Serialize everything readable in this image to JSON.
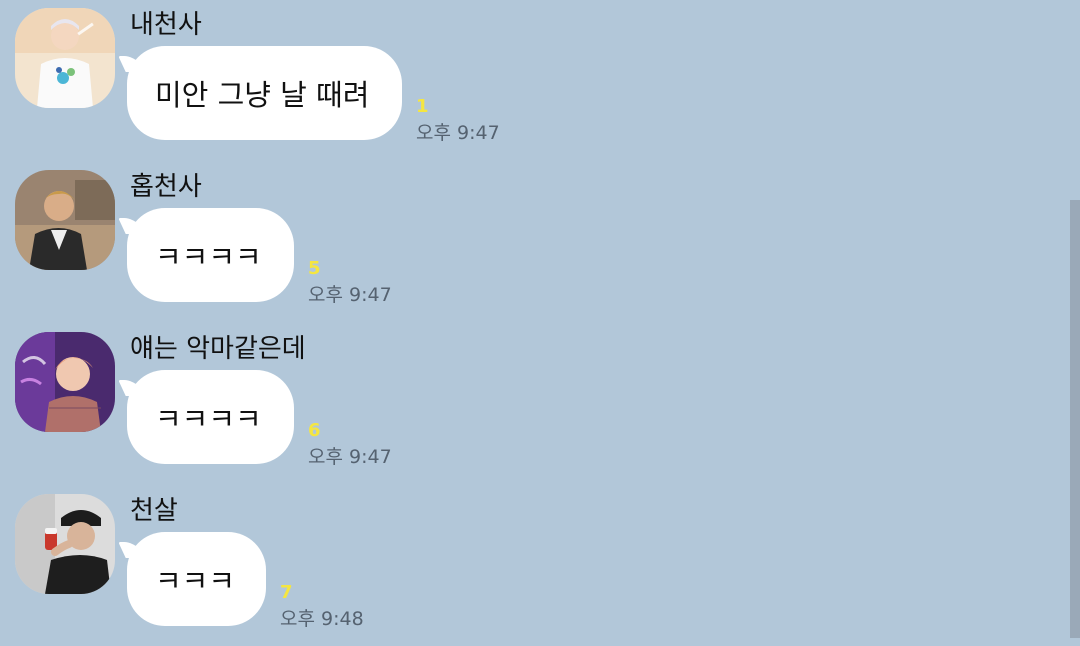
{
  "messages": [
    {
      "sender": "내천사",
      "text": "미안 그냥 날 때려",
      "unread": "1",
      "time": "오후 9:47",
      "avatar": "avatar-white-shirt"
    },
    {
      "sender": "홉천사",
      "text": "ㅋㅋㅋㅋ",
      "unread": "5",
      "time": "오후 9:47",
      "avatar": "avatar-outdoor"
    },
    {
      "sender": "얘는 악마같은데",
      "text": "ㅋㅋㅋㅋ",
      "unread": "6",
      "time": "오후 9:47",
      "avatar": "avatar-neon-purple"
    },
    {
      "sender": "천살",
      "text": "ㅋㅋㅋ",
      "unread": "7",
      "time": "오후 9:48",
      "avatar": "avatar-black-cap"
    }
  ],
  "colors": {
    "background": "#b2c7d9",
    "bubble": "#ffffff",
    "unread": "#f5e640",
    "time": "#556270"
  }
}
